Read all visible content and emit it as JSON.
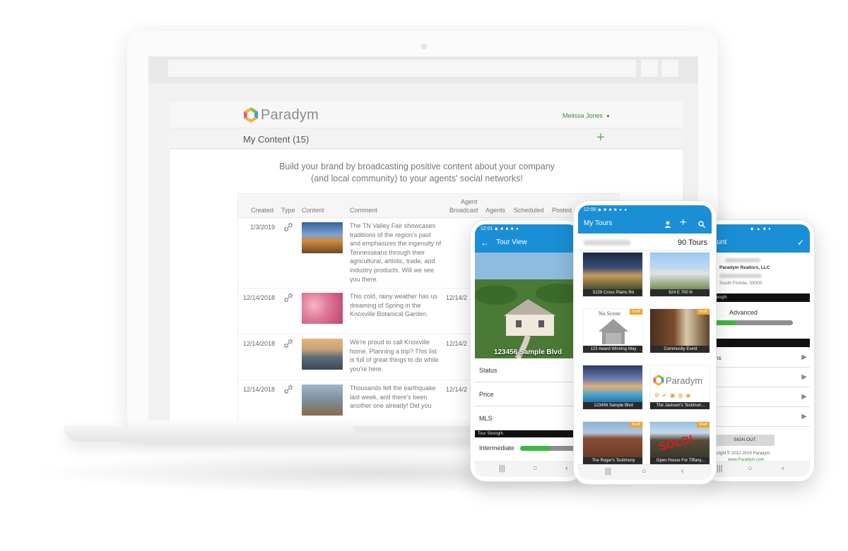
{
  "laptop": {
    "brand": "Paradym",
    "user_name": "Melissa Jones",
    "content_title": "My Content (15)",
    "add_icon": "plus-icon",
    "tagline_line1": "Build your brand by broadcasting positive content about your company",
    "tagline_line2": "(and local community) to your agents' social networks!",
    "table": {
      "headers": {
        "created": "Created",
        "type": "Type",
        "content": "Content",
        "comment": "Comment",
        "agent_broadcast_1": "Agent",
        "agent_broadcast_2": "Broadcast",
        "agents": "Agents",
        "scheduled": "Scheduled",
        "posted": "Posted"
      },
      "rows": [
        {
          "created": "1/3/2019",
          "comment": "The TN Valley Fair showcases traditions of the region's past and emphasizes the ingenuity of Tennesseans through their agricultural, artistic, trade, and industry products. Will we see you there.",
          "broadcast": ""
        },
        {
          "created": "12/14/2018",
          "comment": "This cold, rainy weather has us dreaming of Spring in the Knoxville Botanical Garden.",
          "broadcast": "12/14/2"
        },
        {
          "created": "12/14/2018",
          "comment": "We're proud to call Knoxville home. Planning a trip? This list is full of great things to do while you're here.",
          "broadcast": "12/14/2"
        },
        {
          "created": "12/14/2018",
          "comment": "Thousands felt the earthquake last week, and there's been another one already! Did you",
          "broadcast": "12/14/2"
        }
      ]
    }
  },
  "phone1": {
    "time": "12:01",
    "title": "Tour View",
    "back_icon": "arrow-left-icon",
    "hero_caption": "123456  Sample Blvd",
    "rows": [
      "Status",
      "Price",
      "MLS"
    ],
    "strength_label": "Tour Strength",
    "level": "Intermediate",
    "level_fraction": 0.5
  },
  "phone2": {
    "time": "12:00",
    "title": "My Tours",
    "tour_count": "90 Tours",
    "tiles": [
      {
        "caption": "5228 Cross Plains Rd",
        "draft": ""
      },
      {
        "caption": "624 E 700 N",
        "draft": ""
      },
      {
        "caption": "123 Award Winning Way",
        "draft": "Draft",
        "noscene": "No Scene"
      },
      {
        "caption": "Community Event",
        "draft": "Draft"
      },
      {
        "caption": "123456  Sample Blvd",
        "draft": ""
      },
      {
        "caption": "The Jackson's Testimon...",
        "draft": "",
        "logo": "Paradym"
      },
      {
        "caption": "The Roger's Testimony",
        "draft": "Draft"
      },
      {
        "caption": "Open House For Tiffany...",
        "draft": "Draft",
        "stamp": "SOLD!"
      }
    ]
  },
  "phone3": {
    "title": "count",
    "company": "Paradym Realtors, LLC",
    "location": "South Florida, 33000",
    "strength_label": "Strength",
    "level": "Advanced",
    "level_fraction": 0.3,
    "menu": [
      "ions",
      "",
      "",
      ""
    ],
    "signout": "SIGN OUT",
    "copyright": "opyright © 2012-2019 Paradym",
    "website": "www.Paradym.com"
  },
  "colors": {
    "brand_blue": "#1a8fd6",
    "accent_green": "#3db93d",
    "draft_orange": "#f0a32a"
  }
}
